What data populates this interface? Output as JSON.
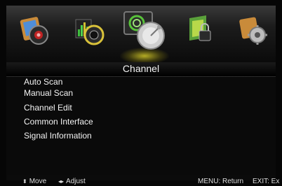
{
  "icons": [
    {
      "name": "picture-icon"
    },
    {
      "name": "sound-icon"
    },
    {
      "name": "channel-icon",
      "selected": true
    },
    {
      "name": "lock-icon"
    },
    {
      "name": "setup-icon"
    }
  ],
  "header": {
    "title": "Channel"
  },
  "menu": {
    "items": [
      {
        "label": "Auto Scan"
      },
      {
        "label": "Manual Scan"
      },
      {
        "label": "Channel Edit"
      },
      {
        "label": "Common Interface"
      },
      {
        "label": "Signal Information"
      }
    ]
  },
  "footer": {
    "move": {
      "icon": "up-down-arrows-icon",
      "glyph": "⬍",
      "label": "Move"
    },
    "adjust": {
      "icon": "left-right-arrows-icon",
      "glyph": "◂▸",
      "label": "Adjust"
    },
    "menu_return": "MENU: Return",
    "exit": "EXIT: Ex"
  }
}
